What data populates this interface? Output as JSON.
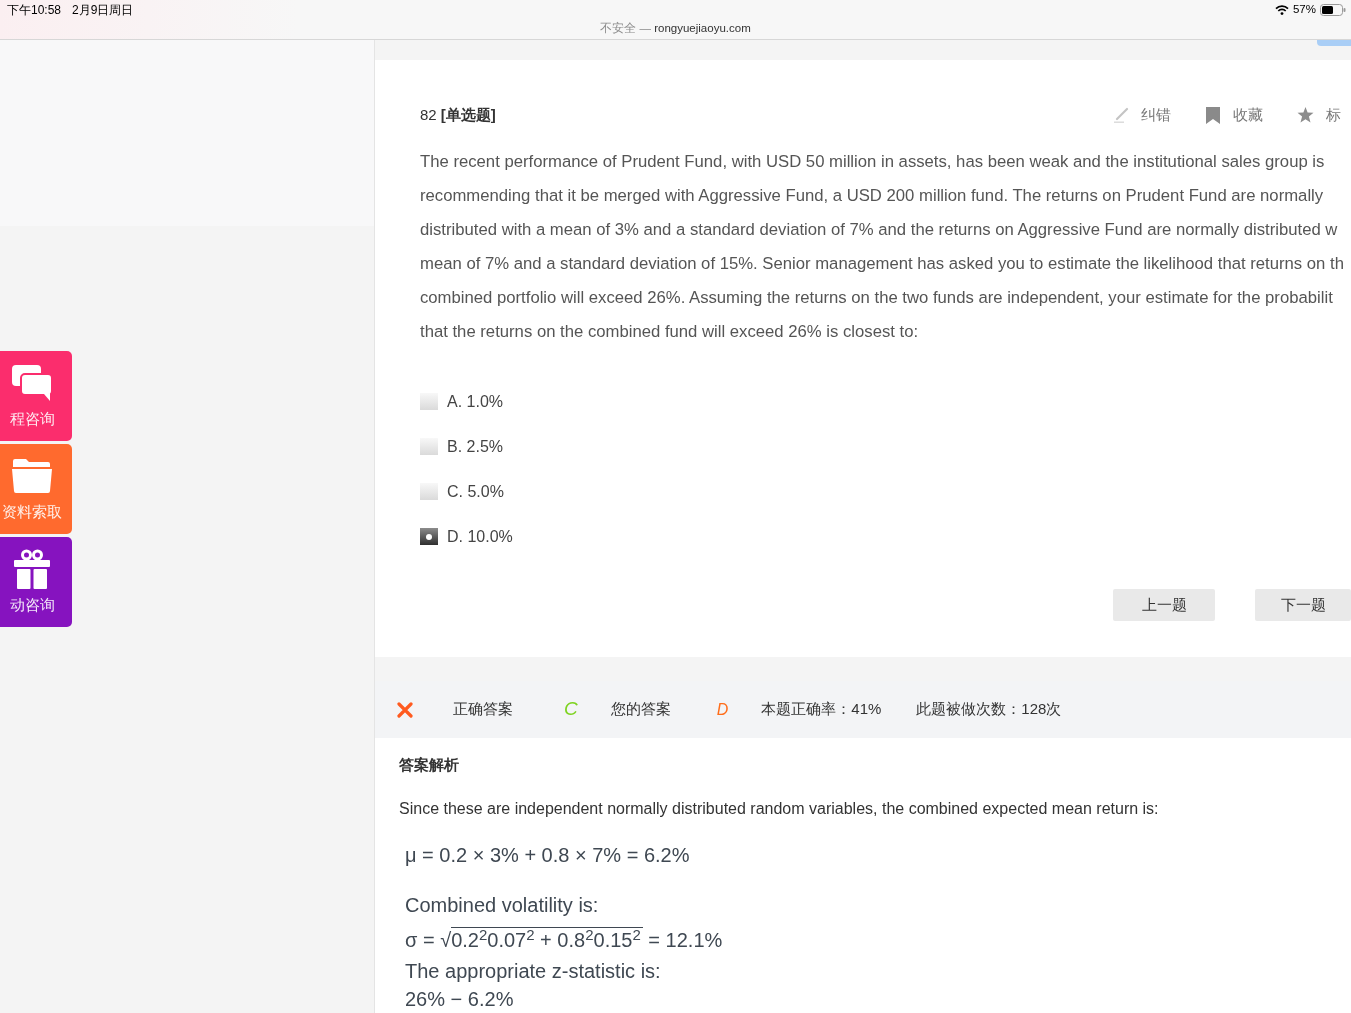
{
  "status_bar": {
    "time": "下午10:58",
    "date": "2月9日周日",
    "battery": "57%"
  },
  "address_bar": {
    "security": "不安全 —",
    "domain": "rongyuejiaoyu.com"
  },
  "side_buttons": [
    {
      "kind": "chat",
      "label": "程咨询",
      "color": "#fb2d6d"
    },
    {
      "kind": "folder",
      "label": "资料索取",
      "color": "#ff6a2e"
    },
    {
      "kind": "gift",
      "label": "动咨询",
      "color": "#8613bf"
    }
  ],
  "question": {
    "header": "82 **[单选题]**",
    "tools": [
      {
        "kind": "edit",
        "label": "纠错"
      },
      {
        "kind": "bookmark",
        "label": "收藏"
      },
      {
        "kind": "star",
        "label": "标"
      }
    ],
    "text_lines": [
      "The recent performance of Prudent Fund, with USD 50 million in assets, has been weak and the institutional sales group is",
      "recommending that it be merged with Aggressive Fund, a USD 200 million fund. The returns on Prudent Fund are normally",
      "distributed with a mean of 3% and a standard deviation of 7% and the returns on Aggressive Fund are normally distributed w",
      "mean of 7% and a standard deviation of 15%. Senior management has asked you to estimate the likelihood that returns on th",
      "combined portfolio will exceed 26%. Assuming the returns on the two funds are independent, your estimate for the probabilit",
      "that the returns on the combined fund will exceed 26% is closest to:"
    ],
    "options": [
      {
        "label": "A. 1.0%",
        "selected": false
      },
      {
        "label": "B. 2.5%",
        "selected": false
      },
      {
        "label": "C. 5.0%",
        "selected": false
      },
      {
        "label": "D. 10.0%",
        "selected": true
      }
    ],
    "nav_buttons": [
      "上一题",
      "下一题"
    ]
  },
  "result": {
    "correct": false,
    "correct_label": "正确答案",
    "correct_answer": "C",
    "your_label": "您的答案",
    "your_answer": "D",
    "accuracy": "本题正确率：41%",
    "attempts": "此题被做次数：128次"
  },
  "explanation": {
    "title": "答案解析",
    "intro": "Since these are independent normally distributed random variables, the combined expected mean return is:",
    "steps": [
      {
        "kind": "equation",
        "text": "μ = 0.2 × 3% + 0.8 × 7% = 6.2%"
      },
      {
        "kind": "text",
        "text": "Combined volatility is:"
      },
      {
        "kind": "sqrt",
        "lhs": "σ = √",
        "radicand": "0.2$^{2}$0.07$^{2}$ + 0.8$^{2}$0.15$^{2}$",
        "rhs": "= 12.1%"
      },
      {
        "kind": "text",
        "text": "The appropriate z-statistic is:"
      },
      {
        "kind": "equation",
        "text": "26% − 6.2%"
      }
    ]
  }
}
